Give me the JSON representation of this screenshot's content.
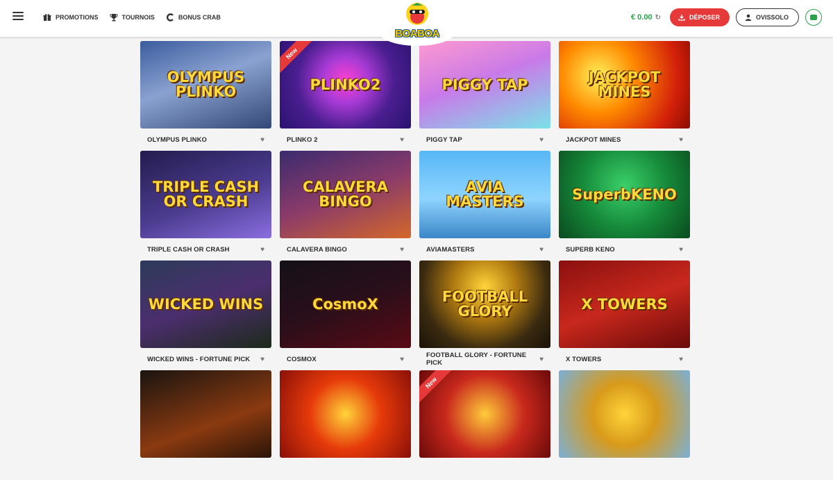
{
  "header": {
    "nav": [
      {
        "label": "PROMOTIONS",
        "icon": "gift-icon"
      },
      {
        "label": "TOURNOIS",
        "icon": "trophy-icon"
      },
      {
        "label": "BONUS CRAB",
        "icon": "crab-c-icon"
      }
    ],
    "logo_text": "BOABOA",
    "balance": "€ 0.00",
    "deposit_label": "DÉPOSER",
    "user_label": "OVISSOLO"
  },
  "colors": {
    "accent_red": "#e63a3a",
    "accent_green": "#2aa14a",
    "logo_yellow": "#f6c600"
  },
  "games": [
    {
      "name": "OLYMPUS PLINKO",
      "art": "OLYMPUS PLINKO",
      "bg": "linear-gradient(160deg,#3b5c9e 0%,#8aa2d0 45%,#324877 100%)",
      "new": false
    },
    {
      "name": "PLINKO 2",
      "art": "PLINKO2",
      "bg": "radial-gradient(circle at 50% 45%,#ff3fd0 0%,#a93bd6 28%,#4a1e8f 60%,#2a1270 100%)",
      "new": true
    },
    {
      "name": "PIGGY TAP",
      "art": "PIGGY TAP",
      "bg": "linear-gradient(160deg,#ff9ad0 0%,#c97ae8 45%,#7be2e8 100%)",
      "new": false
    },
    {
      "name": "JACKPOT MINES",
      "art": "JACKPOT MINES",
      "bg": "radial-gradient(circle at 30% 40%,#fff15a 0%,#ff8a00 35%,#d3200a 75%,#8a0d00 100%)",
      "new": false
    },
    {
      "name": "TRIPLE CASH OR CRASH",
      "art": "TRIPLE CASH OR CRASH",
      "bg": "linear-gradient(160deg,#241c4e 0%,#4b3c8f 55%,#8a6ee0 100%)",
      "new": false
    },
    {
      "name": "CALAVERA BINGO",
      "art": "CALAVERA BINGO",
      "bg": "linear-gradient(160deg,#3b2b6e 0%,#8a3b6a 50%,#d3682a 100%)",
      "new": false
    },
    {
      "name": "AVIAMASTERS",
      "art": "AVIA MASTERS",
      "bg": "linear-gradient(180deg,#57b7f5 0%,#8fd4ff 55%,#3a86c7 100%)",
      "new": false
    },
    {
      "name": "SUPERB KENO",
      "art": "SuperbKENO",
      "bg": "radial-gradient(circle at 50% 40%,#3bd06a 0%,#168a3a 50%,#0a4a1e 100%)",
      "new": false
    },
    {
      "name": "WICKED WINS - FORTUNE PICK",
      "art": "WICKED WINS",
      "bg": "linear-gradient(160deg,#2d3b5a 0%,#4b2e6e 50%,#1d2a1a 100%)",
      "new": false
    },
    {
      "name": "COSMOX",
      "art": "CosmoX",
      "bg": "linear-gradient(160deg,#141018 0%,#2a0f1a 50%,#5a0a14 100%)",
      "new": false
    },
    {
      "name": "FOOTBALL GLORY - FORTUNE PICK",
      "art": "FOOTBALL GLORY",
      "bg": "radial-gradient(circle at 50% 30%,#ffd43a 0%,#b07a10 35%,#3a2a10 70%,#1a1208 100%)",
      "new": false
    },
    {
      "name": "X TOWERS",
      "art": "X TOWERS",
      "bg": "linear-gradient(160deg,#8a1010 0%,#c8281c 50%,#6a0a0a 100%)",
      "new": false
    },
    {
      "name": "",
      "art": "",
      "bg": "linear-gradient(160deg,#1a1410 0%,#8a3a10 60%,#2a1408 100%)",
      "new": false
    },
    {
      "name": "",
      "art": "",
      "bg": "radial-gradient(circle at 50% 50%,#ffd43a 0%,#e63a0a 45%,#8a1008 100%)",
      "new": false
    },
    {
      "name": "",
      "art": "",
      "bg": "radial-gradient(circle at 50% 50%,#ffcb3a 0%,#c8281c 50%,#6a0a0a 100%)",
      "new": true
    },
    {
      "name": "",
      "art": "",
      "bg": "radial-gradient(circle at 50% 50%,#ffd43a 0%,#d89a1a 40%,#7ab0d8 100%)",
      "new": false
    }
  ],
  "new_badge_label": "New"
}
